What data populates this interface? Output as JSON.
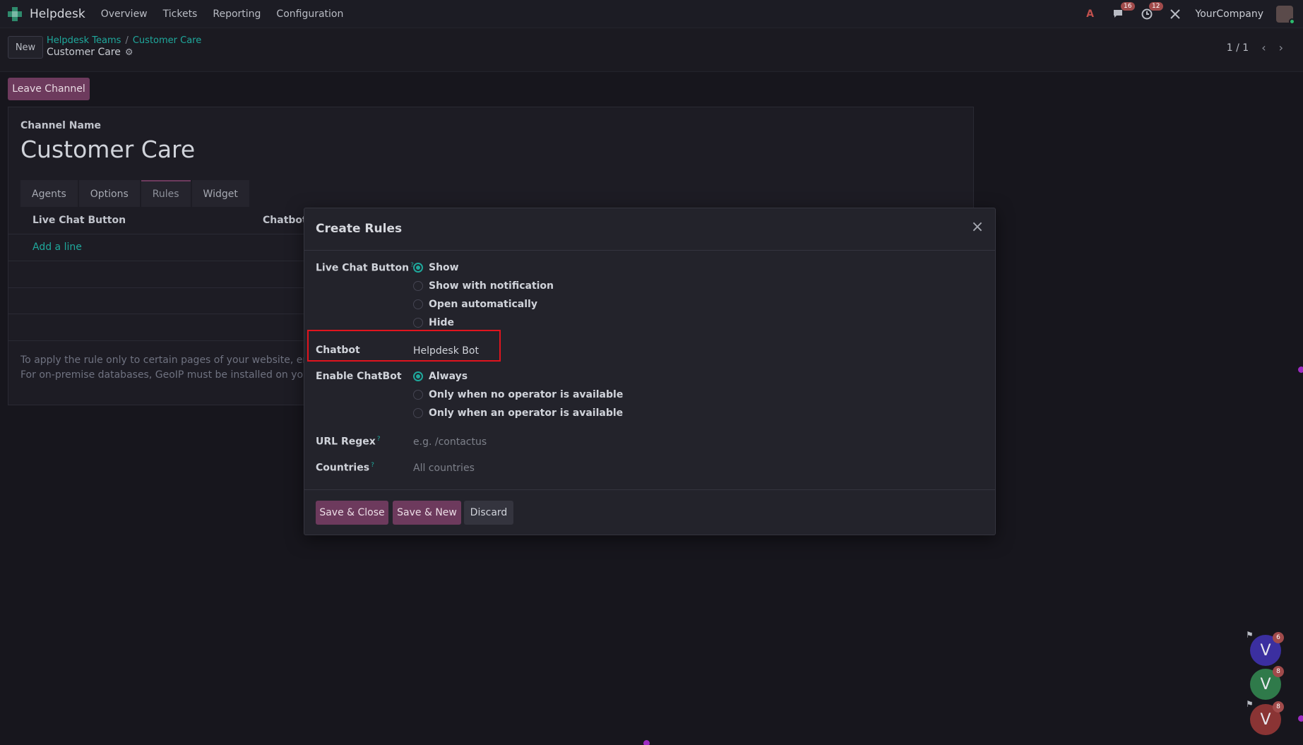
{
  "navbar": {
    "app_name": "Helpdesk",
    "menu": [
      "Overview",
      "Tickets",
      "Reporting",
      "Configuration"
    ],
    "messages_count": "16",
    "activities_count": "12",
    "company": "YourCompany"
  },
  "control": {
    "new_label": "New",
    "breadcrumb": [
      "Helpdesk Teams",
      "Customer Care"
    ],
    "record_title": "Customer Care",
    "pager": "1 / 1"
  },
  "form": {
    "leave_label": "Leave Channel",
    "channel_label": "Channel Name",
    "channel_name": "Customer Care",
    "tabs": [
      "Agents",
      "Options",
      "Rules",
      "Widget"
    ],
    "active_tab": "Rules",
    "columns": [
      "Live Chat Button",
      "Chatbot"
    ],
    "add_line": "Add a line",
    "help_line1": "To apply the rule only to certain pages of your website, enter a",
    "help_line2": "For on-premise databases, GeoIP must be installed on your serv"
  },
  "modal": {
    "title": "Create Rules",
    "live_chat_label": "Live Chat Button",
    "live_chat_options": [
      "Show",
      "Show with notification",
      "Open automatically",
      "Hide"
    ],
    "live_chat_selected": "Show",
    "chatbot_label": "Chatbot",
    "chatbot_value": "Helpdesk Bot",
    "enable_chatbot_label": "Enable ChatBot",
    "enable_chatbot_options": [
      "Always",
      "Only when no operator is available",
      "Only when an operator is available"
    ],
    "enable_chatbot_selected": "Always",
    "url_regex_label": "URL Regex",
    "url_regex_placeholder": "e.g. /contactus",
    "countries_label": "Countries",
    "countries_placeholder": "All countries",
    "help_mark": "?",
    "save_close": "Save & Close",
    "save_new": "Save & New",
    "discard": "Discard"
  },
  "chat_bubbles": [
    {
      "letter": "V",
      "count": "6",
      "color": "#3b2fa0"
    },
    {
      "letter": "V",
      "count": "8",
      "color": "#2f7a4a"
    },
    {
      "letter": "V",
      "count": "8",
      "color": "#8a3434"
    }
  ],
  "colors": {
    "accent": "#6d3a5d",
    "link": "#1fa89c",
    "highlight_box": "#e0141e"
  }
}
